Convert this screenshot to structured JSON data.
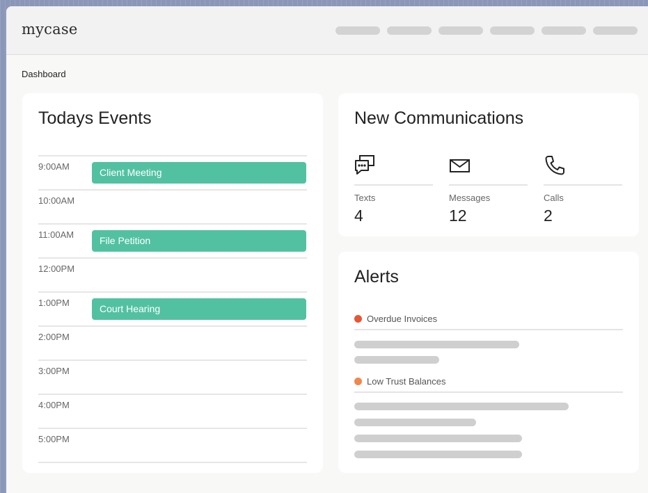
{
  "app": {
    "logo_text": "mycase"
  },
  "breadcrumb": "Dashboard",
  "events": {
    "title": "Todays Events",
    "slots": [
      {
        "time": "9:00AM",
        "event": "Client Meeting"
      },
      {
        "time": "10:00AM",
        "event": ""
      },
      {
        "time": "11:00AM",
        "event": "File Petition"
      },
      {
        "time": "12:00PM",
        "event": ""
      },
      {
        "time": "1:00PM",
        "event": "Court Hearing"
      },
      {
        "time": "2:00PM",
        "event": ""
      },
      {
        "time": "3:00PM",
        "event": ""
      },
      {
        "time": "4:00PM",
        "event": ""
      },
      {
        "time": "5:00PM",
        "event": ""
      }
    ]
  },
  "communications": {
    "title": "New Communications",
    "items": [
      {
        "label": "Texts",
        "count": "4",
        "icon": "chat-bubbles-icon"
      },
      {
        "label": "Messages",
        "count": "12",
        "icon": "envelope-icon"
      },
      {
        "label": "Calls",
        "count": "2",
        "icon": "phone-icon"
      }
    ]
  },
  "alerts": {
    "title": "Alerts",
    "items": [
      {
        "label": "Overdue Invoices",
        "color": "#e85535"
      },
      {
        "label": "Low Trust Balances",
        "color": "#f0884a"
      }
    ]
  },
  "colors": {
    "event_green": "#52c1a2",
    "alert_red": "#e85535",
    "alert_orange": "#f0884a"
  }
}
